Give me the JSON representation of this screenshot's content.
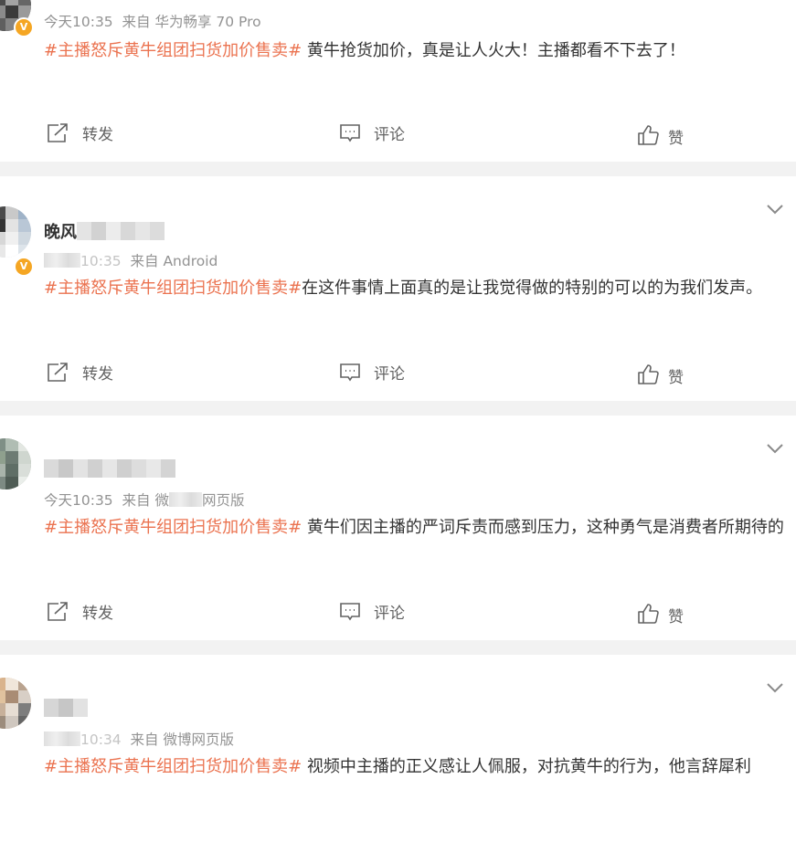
{
  "actions": {
    "repost": "转发",
    "comment": "评论",
    "like": "赞"
  },
  "colors": {
    "topic": "#eb7350",
    "verified": "#f5a623",
    "separator": "#f2f2f2"
  },
  "icons": [
    "repost-icon",
    "comment-icon",
    "like-icon",
    "chevron-down-icon",
    "verified-badge-icon"
  ],
  "posts": [
    {
      "name": "",
      "verified_badge": "V",
      "time": "今天10:35",
      "source": "来自 华为畅享 70 Pro",
      "topic": "#主播怒斥黄牛组团扫货加价售卖#",
      "text": " 黄牛抢货加价，真是让人火大！主播都看不下去了！"
    },
    {
      "name": "晚风",
      "verified_badge": "V",
      "time": "10:35",
      "source": "来自 Android",
      "topic": "#主播怒斥黄牛组团扫货加价售卖#",
      "text": "在这件事情上面真的是让我觉得做的特别的可以的为我们发声。"
    },
    {
      "name": "",
      "time": "今天10:35",
      "source_prefix": "来自 微",
      "source_suffix": "网页版",
      "topic": "#主播怒斥黄牛组团扫货加价售卖#",
      "text": " 黄牛们因主播的严词斥责而感到压力，这种勇气是消费者所期待的"
    },
    {
      "name": "",
      "time": "10:34",
      "source": "来自 微博网页版",
      "topic": "#主播怒斥黄牛组团扫货加价售卖#",
      "text": " 视频中主播的正义感让人佩服，对抗黄牛的行为，他言辞犀利"
    }
  ]
}
